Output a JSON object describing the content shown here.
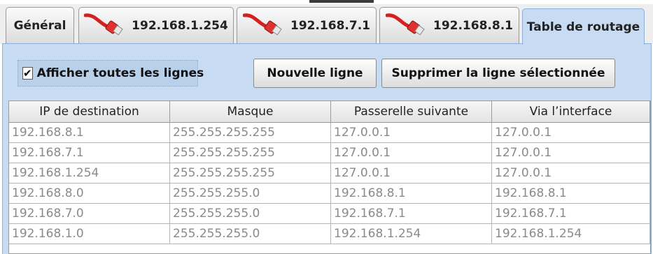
{
  "tabs": [
    {
      "label": "Général",
      "icon": "network-cable-icon",
      "has_icon": false,
      "active": false
    },
    {
      "label": "192.168.1.254",
      "icon": "network-cable-icon",
      "has_icon": true,
      "active": false
    },
    {
      "label": "192.168.7.1",
      "icon": "network-cable-icon",
      "has_icon": true,
      "active": false
    },
    {
      "label": "192.168.8.1",
      "icon": "network-cable-icon",
      "has_icon": true,
      "active": false
    },
    {
      "label": "Table de routage",
      "has_icon": false,
      "active": true
    }
  ],
  "toolbar": {
    "show_all_label": "Afficher toutes les lignes",
    "show_all_checked": true,
    "check_mark": "✔",
    "new_line_label": "Nouvelle ligne",
    "delete_line_label": "Supprimer la ligne sélectionnée"
  },
  "table": {
    "columns": [
      "IP de destination",
      "Masque",
      "Passerelle suivante",
      "Via l’interface"
    ],
    "rows": [
      [
        "192.168.8.1",
        "255.255.255.255",
        "127.0.0.1",
        "127.0.0.1"
      ],
      [
        "192.168.7.1",
        "255.255.255.255",
        "127.0.0.1",
        "127.0.0.1"
      ],
      [
        "192.168.1.254",
        "255.255.255.255",
        "127.0.0.1",
        "127.0.0.1"
      ],
      [
        "192.168.8.0",
        "255.255.255.0",
        "192.168.8.1",
        "192.168.8.1"
      ],
      [
        "192.168.7.0",
        "255.255.255.0",
        "192.168.7.1",
        "192.168.7.1"
      ],
      [
        "192.168.1.0",
        "255.255.255.0",
        "192.168.1.254",
        "192.168.1.254"
      ]
    ]
  },
  "colors": {
    "panel_bg": "#c7dcf2",
    "cable_red": "#d42020",
    "row_text": "#8a8a8a"
  }
}
